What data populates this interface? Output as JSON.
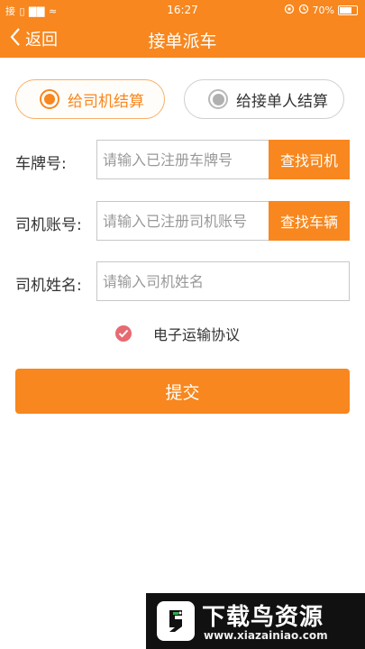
{
  "status_bar": {
    "left": "接 ▯ ▇▇ ≈",
    "time": "16:27",
    "battery_text": "70%",
    "battery_level": 0.7
  },
  "nav": {
    "back_label": "返回",
    "title": "接单派车"
  },
  "settlement": {
    "option1": "给司机结算",
    "option2": "给接单人结算",
    "selected": "option1"
  },
  "form": {
    "plate": {
      "label": "车牌号:",
      "placeholder": "请输入已注册车牌号",
      "value": "",
      "button": "查找司机"
    },
    "account": {
      "label": "司机账号:",
      "placeholder": "请输入已注册司机账号",
      "value": "",
      "button": "查找车辆"
    },
    "name": {
      "label": "司机姓名:",
      "placeholder": "请输入司机姓名",
      "value": ""
    }
  },
  "agreement": {
    "label": "电子运输协议",
    "checked": true
  },
  "submit_label": "提交",
  "watermark": {
    "title": "下载鸟资源",
    "url": "www.xiazainiao.com"
  },
  "colors": {
    "accent": "#f7871e",
    "check": "#e76a72"
  }
}
